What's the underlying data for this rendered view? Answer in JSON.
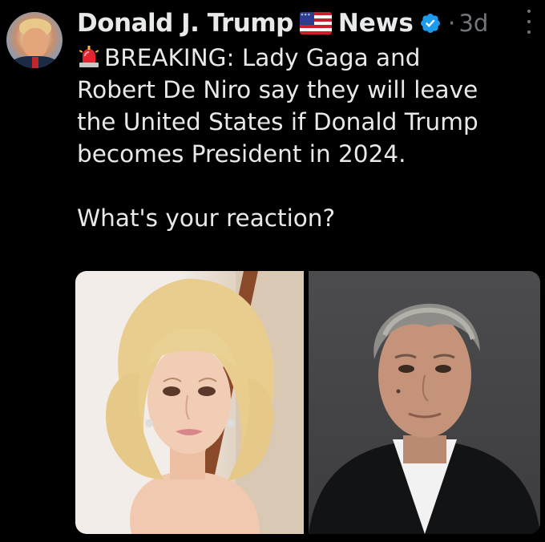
{
  "post": {
    "author_name": "Donald J. Trump",
    "author_suffix": "News",
    "time": "3d",
    "separator": "·",
    "breaking_line": "BREAKING: Lady Gaga and",
    "body_rest": "Robert De Niro say they will leave\nthe United States if Donald Trump\nbecomes President in 2024.\n\nWhat's your reaction?"
  },
  "icons": {
    "flag": "us-flag-icon",
    "verified": "verified-badge-icon",
    "siren": "police-light-emoji",
    "more": "more-options-icon"
  },
  "colors": {
    "background": "#000000",
    "text": "#e7e9ea",
    "muted": "#71767b",
    "verified": "#1d9bf0"
  }
}
